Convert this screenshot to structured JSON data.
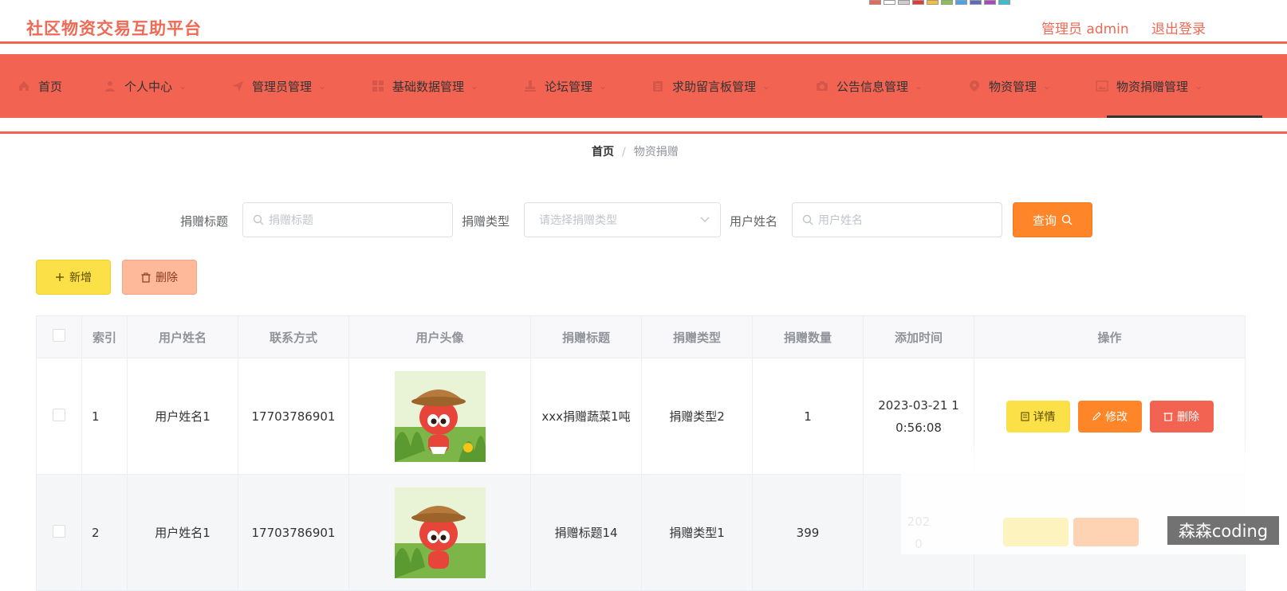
{
  "header": {
    "brand": "社区物资交易互助平台",
    "admin_label": "管理员 admin",
    "logout_label": "退出登录",
    "theme_colors": [
      "#f36352",
      "#ffffff",
      "#cfcfcf",
      "#e53935",
      "#fbc02d",
      "#8bc34a",
      "#42a5f5",
      "#5c6bc0",
      "#ab47bc",
      "#26c6da"
    ]
  },
  "nav": {
    "items": [
      {
        "label": "首页",
        "icon": "home-icon"
      },
      {
        "label": "个人中心",
        "icon": "user-icon"
      },
      {
        "label": "管理员管理",
        "icon": "send-icon"
      },
      {
        "label": "基础数据管理",
        "icon": "grid-icon"
      },
      {
        "label": "论坛管理",
        "icon": "stamp-icon"
      },
      {
        "label": "求助留言板管理",
        "icon": "clipboard-icon"
      },
      {
        "label": "公告信息管理",
        "icon": "camera-icon"
      },
      {
        "label": "物资管理",
        "icon": "location-icon"
      },
      {
        "label": "物资捐赠管理",
        "icon": "picture-icon"
      }
    ],
    "active_index": 8
  },
  "breadcrumb": {
    "home": "首页",
    "separator": "/",
    "current": "物资捐赠"
  },
  "filters": {
    "title_label": "捐赠标题",
    "title_placeholder": "捐赠标题",
    "type_label": "捐赠类型",
    "type_placeholder": "请选择捐赠类型",
    "user_label": "用户姓名",
    "user_placeholder": "用户姓名",
    "query_button": "查询"
  },
  "toolbar": {
    "add_label": "新增",
    "delete_label": "删除"
  },
  "table": {
    "columns": [
      "索引",
      "用户姓名",
      "联系方式",
      "用户头像",
      "捐赠标题",
      "捐赠类型",
      "捐赠数量",
      "添加时间",
      "操作"
    ],
    "rows": [
      {
        "index": "1",
        "user": "用户姓名1",
        "phone": "17703786901",
        "title": "xxx捐赠蔬菜1吨",
        "type": "捐赠类型2",
        "qty": "1",
        "time_line1": "2023-03-21 1",
        "time_line2": "0:56:08"
      },
      {
        "index": "2",
        "user": "用户姓名1",
        "phone": "17703786901",
        "title": "捐赠标题14",
        "type": "捐赠类型1",
        "qty": "399",
        "time_line1": "202",
        "time_line2": "0"
      }
    ],
    "actions": {
      "detail": "详情",
      "edit": "修改",
      "delete": "删除"
    }
  },
  "watermark": "森森coding",
  "colors": {
    "accent": "#f36352",
    "orange": "#fe8528",
    "yellow": "#fbe048",
    "peach": "#fdb99a"
  }
}
